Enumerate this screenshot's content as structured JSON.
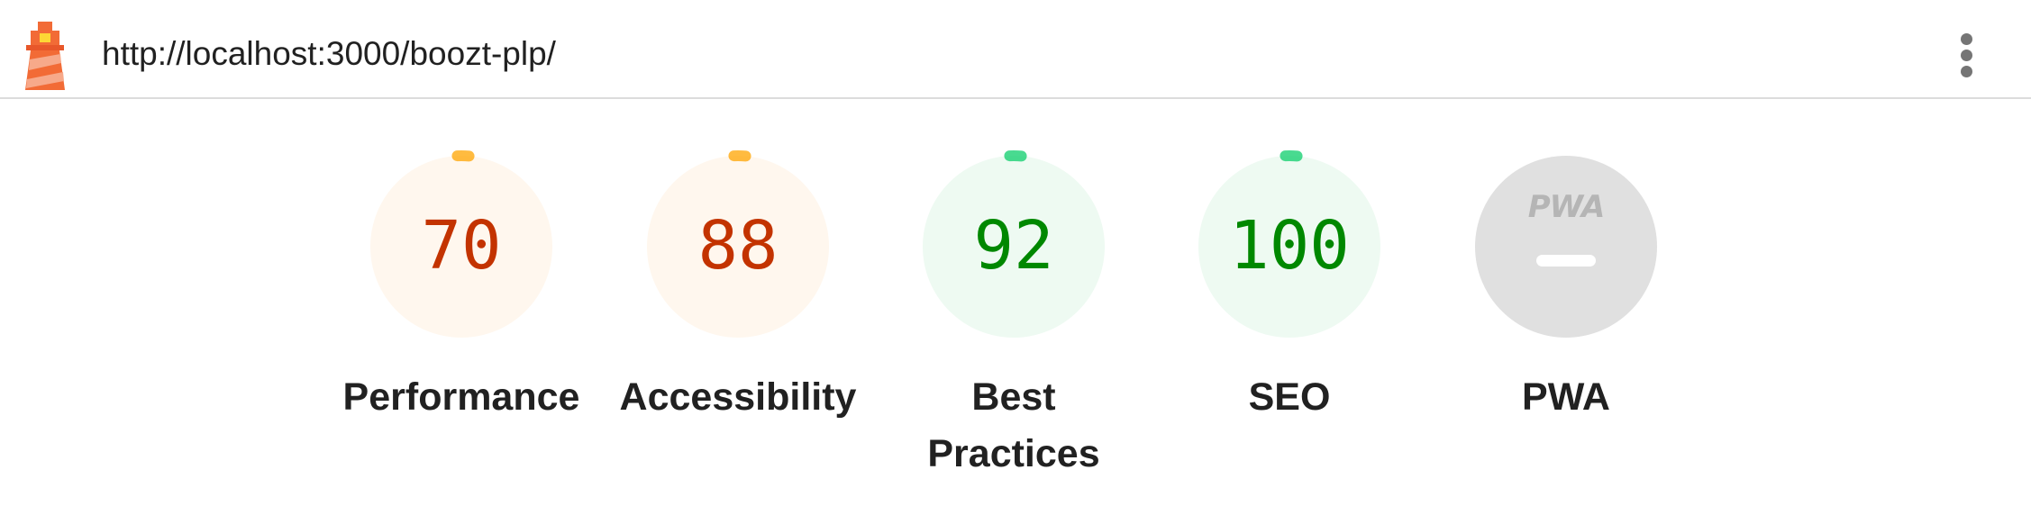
{
  "header": {
    "url": "http://localhost:3000/boozt-plp/",
    "logo_icon": "lighthouse-icon",
    "menu_icon": "kebab-menu-icon"
  },
  "colors": {
    "average_fill": "#fff7ee",
    "average_arc": "#ffa400",
    "average_text": "#c33300",
    "pass_fill": "#eefaf2",
    "pass_arc": "#0cce6b",
    "pass_text": "#008800",
    "na_fill": "#e0e0e0"
  },
  "gauges": [
    {
      "score": "70",
      "label": "Performance",
      "status": "average",
      "fraction": 0.7
    },
    {
      "score": "88",
      "label": "Accessibility",
      "status": "average",
      "fraction": 0.88
    },
    {
      "score": "92",
      "label": "Best Practices",
      "status": "pass",
      "fraction": 0.92
    },
    {
      "score": "100",
      "label": "SEO",
      "status": "pass",
      "fraction": 1.0
    },
    {
      "score": "",
      "label": "PWA",
      "status": "na",
      "badge_text": "PWA"
    }
  ]
}
